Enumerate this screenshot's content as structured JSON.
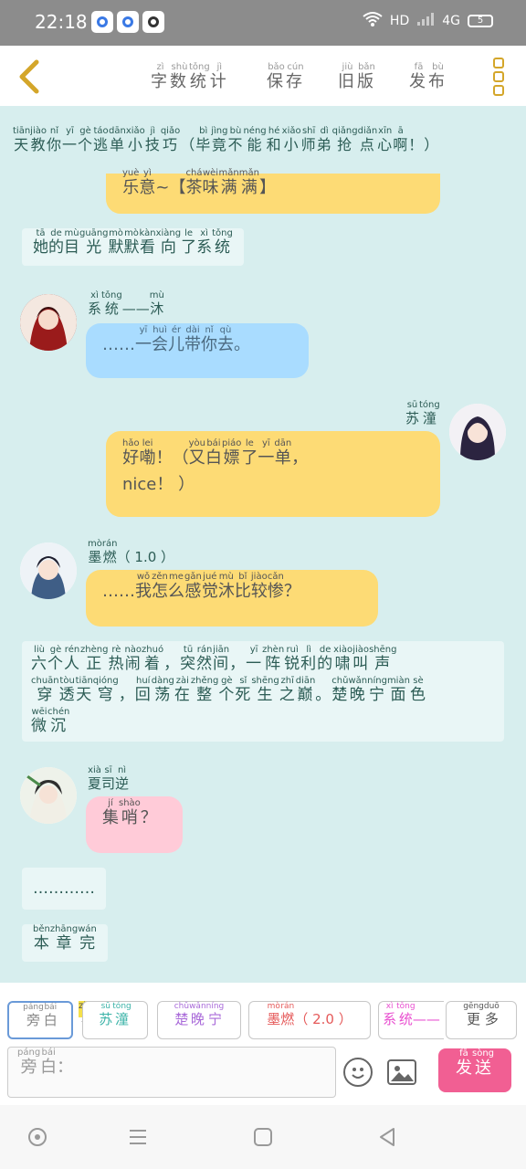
{
  "status_bar": {
    "time": "22:18",
    "network": "HD",
    "signal": "4G",
    "battery": "5",
    "icons": [
      "qq-icon",
      "browser-icon",
      "baidu-icon",
      "wifi-icon",
      "signal-icon",
      "battery-icon"
    ]
  },
  "toolbar": {
    "back_icon": "chevron-left-icon",
    "word_count": {
      "text": [
        "字",
        "数",
        "统",
        "计"
      ],
      "pinyin": [
        "zì",
        "shù",
        "tǒng",
        "jì"
      ]
    },
    "save": {
      "text": [
        "保",
        "存"
      ],
      "pinyin": [
        "bǎo",
        "cún"
      ]
    },
    "old_version": {
      "text": [
        "旧",
        "版"
      ],
      "pinyin": [
        "jiù",
        "bǎn"
      ]
    },
    "publish": {
      "text": [
        "发",
        "布"
      ],
      "pinyin": [
        "fā",
        "bù"
      ]
    },
    "more_icon": "more-vertical-icon",
    "accent": "#d4a62a"
  },
  "chat": {
    "narration_top": {
      "pinyin": [
        "tiān",
        "jiào",
        "nǐ",
        "yī",
        "gè",
        "táo",
        "dān",
        "xiǎo",
        "jì",
        "qiǎo",
        "",
        "bì",
        "jìng",
        "bù",
        "néng",
        "hé",
        "xiǎo",
        "shī",
        "dì",
        "qiǎng",
        "diǎn",
        "xīn",
        "ā",
        ""
      ],
      "text": [
        "天",
        "教",
        "你",
        "一",
        "个",
        "逃",
        "单",
        "小",
        "技",
        "巧",
        "（",
        "毕",
        "竟",
        "不",
        "能",
        "和",
        "小",
        "师",
        "弟",
        "抢",
        "点",
        "心",
        "啊",
        "！）"
      ]
    },
    "top_bubble": {
      "pinyin": [
        "yuè",
        "yì",
        "",
        "chá",
        "wèi",
        "mǎn",
        "mǎn",
        ""
      ],
      "text": [
        "乐",
        "意",
        "~【",
        "茶",
        "味",
        "满",
        "满",
        "】"
      ]
    },
    "narration_1": {
      "pinyin": [
        "tā",
        "de",
        "mù",
        "guāng",
        "mò",
        "mò",
        "kàn",
        "xiàng",
        "le",
        "xì",
        "tǒng"
      ],
      "text": [
        "她",
        "的",
        "目",
        "光",
        "默",
        "默",
        "看",
        "向",
        "了",
        "系",
        "统"
      ]
    },
    "msg_1": {
      "name_pinyin": [
        "xì",
        "tǒng",
        "",
        "mù"
      ],
      "name_text": [
        "系",
        "统",
        "——",
        "沐"
      ],
      "pinyin": [
        "",
        "yī",
        "huì",
        "ér",
        "dài",
        "nǐ",
        "qù",
        ""
      ],
      "text": [
        "……",
        "一",
        "会",
        "儿",
        "带",
        "你",
        "去",
        "。"
      ],
      "color": "#a9dcff"
    },
    "msg_2": {
      "name_pinyin": [
        "sū",
        "tóng"
      ],
      "name_text": [
        "苏",
        "潼"
      ],
      "line1_pinyin": [
        "hǎo",
        "lei",
        "",
        "yòu",
        "bái",
        "piáo",
        "le",
        "yī",
        "dān",
        ""
      ],
      "line1_text": [
        "好",
        "嘞",
        "！（",
        "又",
        "白",
        "嫖",
        "了",
        "一",
        "单",
        "，"
      ],
      "line2": "nice！ ）",
      "color": "#fddb75"
    },
    "msg_3": {
      "name_pinyin": [
        "mò",
        "rán"
      ],
      "name_text": [
        "墨",
        "燃"
      ],
      "name_suffix": "（ 1.0 ）",
      "pinyin": [
        "",
        "wǒ",
        "zěn",
        "me",
        "gǎn",
        "jué",
        "mù",
        "bǐ",
        "jiào",
        "cǎn",
        ""
      ],
      "text": [
        "……",
        "我",
        "怎",
        "么",
        "感",
        "觉",
        "沐",
        "比",
        "较",
        "惨",
        "？"
      ],
      "color": "#fddb75"
    },
    "narration_2": {
      "line1_pinyin": [
        "liù",
        "gè",
        "rén",
        "zhèng",
        "rè",
        "nào",
        "zhuó",
        "",
        "tū",
        "rán",
        "jiān",
        "",
        "yī",
        "zhèn",
        "ruì",
        "lì",
        "de",
        "xiào",
        "jiào",
        "shēng"
      ],
      "line1_text": [
        "六",
        "个",
        "人",
        "正",
        "热",
        "闹",
        "着",
        "，",
        "突",
        "然",
        "间",
        "，",
        "一",
        "阵",
        "锐",
        "利",
        "的",
        "啸",
        "叫",
        "声"
      ],
      "line2_pinyin": [
        "chuān",
        "tòu",
        "tiān",
        "qióng",
        "",
        "huí",
        "dàng",
        "zài",
        "zhěng",
        "gè",
        "sǐ",
        "shēng",
        "zhī",
        "diān",
        "",
        "chǔ",
        "wǎn",
        "níng",
        "miàn",
        "sè"
      ],
      "line2_text": [
        "穿",
        "透",
        "天",
        "穹",
        "，",
        "回",
        "荡",
        "在",
        "整",
        "个",
        "死",
        "生",
        "之",
        "巅",
        "。",
        "楚",
        "晚",
        "宁",
        "面",
        "色"
      ],
      "line3_pinyin": [
        "wēi",
        "chén"
      ],
      "line3_text": [
        "微",
        "沉"
      ]
    },
    "msg_4": {
      "name_pinyin": [
        "xià",
        "sī",
        "nì"
      ],
      "name_text": [
        "夏",
        "司",
        "逆"
      ],
      "pinyin": [
        "jí",
        "shào",
        ""
      ],
      "text": [
        "集",
        "哨",
        "？"
      ],
      "color": "#ffcbd8"
    },
    "narration_3": {
      "text": "…………"
    },
    "narration_4": {
      "pinyin": [
        "běn",
        "zhāng",
        "wán"
      ],
      "text": [
        "本",
        "章",
        "完"
      ]
    }
  },
  "bottom_bar": {
    "chips": [
      {
        "pinyin": [
          "páng",
          "bái"
        ],
        "text": [
          "旁",
          "白"
        ],
        "color": "#888888",
        "selected": true
      },
      {
        "pinyin": [
          "sū",
          "tóng"
        ],
        "text": [
          "苏",
          "潼"
        ],
        "color": "#3bb3a8",
        "badge": "主",
        "badge_pinyin": "zhǔ"
      },
      {
        "pinyin": [
          "chǔ",
          "wǎn",
          "níng"
        ],
        "text": [
          "楚",
          "晚",
          "宁"
        ],
        "color": "#a96ad9"
      },
      {
        "pinyin": [
          "mò",
          "rán"
        ],
        "text": [
          "墨",
          "燃"
        ],
        "color": "#e55a5a",
        "suffix": "（ 2.0 ）"
      },
      {
        "pinyin": [
          "xì",
          "tǒng"
        ],
        "text": [
          "系",
          "统"
        ],
        "color": "#e94fd0",
        "suffix": "——"
      },
      {
        "pinyin": [
          "gēng",
          "duō"
        ],
        "text": [
          "更",
          "多"
        ],
        "color": "#555555"
      }
    ],
    "input": {
      "pinyin": [
        "páng",
        "bái"
      ],
      "text": [
        "旁",
        "白"
      ],
      "suffix": "："
    },
    "emoji_icon": "emoji-icon",
    "image_icon": "image-icon",
    "send": {
      "pinyin": [
        "fā",
        "sòng"
      ],
      "text": [
        "发",
        "送"
      ],
      "color": "#f15f93"
    }
  },
  "nav_bar": {
    "icons": [
      "home-circle-icon",
      "menu-lines-icon",
      "square-icon",
      "back-triangle-icon"
    ]
  }
}
